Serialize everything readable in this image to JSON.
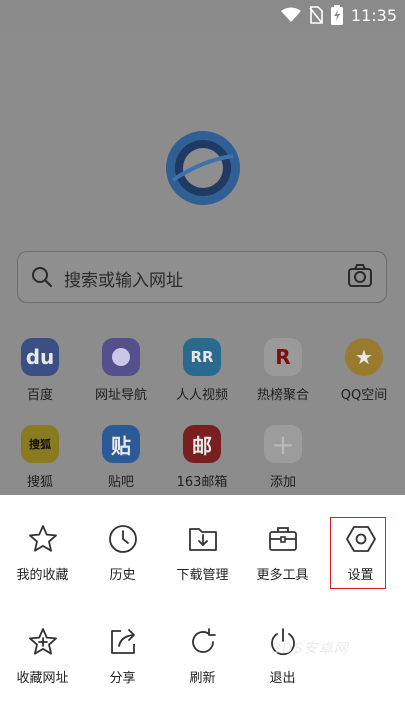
{
  "status_bar": {
    "time": "11:35"
  },
  "search": {
    "placeholder": "搜索或输入网址"
  },
  "shortcuts": [
    {
      "label": "百度",
      "glyph": "du",
      "color": "#3a4f86"
    },
    {
      "label": "网址导航",
      "glyph": "",
      "color": "#554f8c"
    },
    {
      "label": "人人视频",
      "glyph": "RR",
      "color": "#2a6a8e"
    },
    {
      "label": "热榜聚合",
      "glyph": "R",
      "color": "#9a9a9a"
    },
    {
      "label": "QQ空间",
      "glyph": "★",
      "color": "#9a7a2e"
    },
    {
      "label": "搜狐",
      "glyph": "搜狐",
      "color": "#8a7a20"
    },
    {
      "label": "贴吧",
      "glyph": "贴",
      "color": "#2c5a96"
    },
    {
      "label": "163邮箱",
      "glyph": "邮",
      "color": "#7a1f1f"
    },
    {
      "label": "添加",
      "glyph": "+",
      "color": "#9c9c9c"
    }
  ],
  "menu": [
    {
      "label": "我的收藏",
      "icon": "star-icon"
    },
    {
      "label": "历史",
      "icon": "clock-icon"
    },
    {
      "label": "下载管理",
      "icon": "download-folder-icon"
    },
    {
      "label": "更多工具",
      "icon": "toolbox-icon"
    },
    {
      "label": "设置",
      "icon": "gear-hexagon-icon"
    },
    {
      "label": "收藏网址",
      "icon": "star-plus-icon"
    },
    {
      "label": "分享",
      "icon": "share-icon"
    },
    {
      "label": "刷新",
      "icon": "refresh-icon"
    },
    {
      "label": "退出",
      "icon": "power-icon"
    }
  ],
  "watermark": "3DS安卓网",
  "colors": {
    "highlight": "#e02020",
    "dim_overlay": "#8c8c8c"
  }
}
